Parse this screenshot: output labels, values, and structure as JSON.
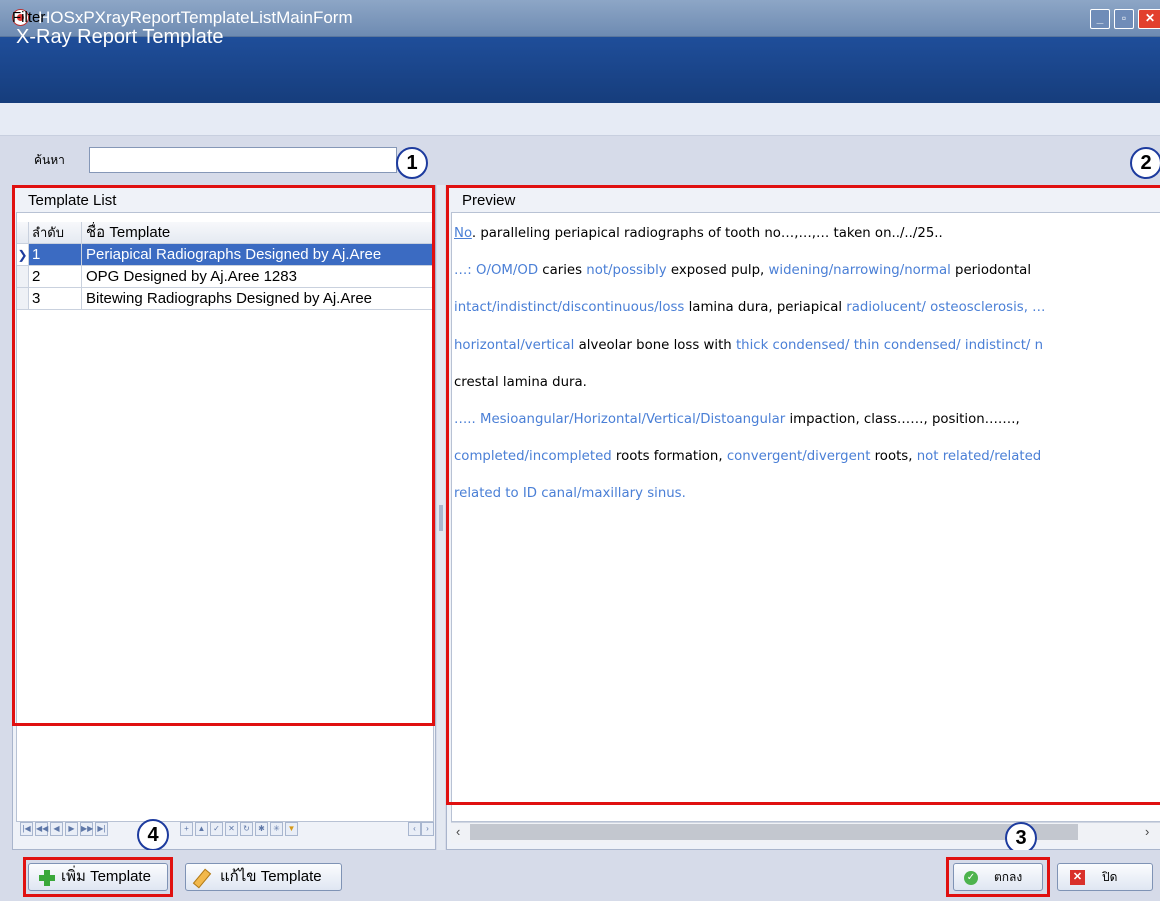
{
  "window": {
    "title": "HOSxPXrayReportTemplateListMainForm"
  },
  "header": {
    "title": "X-Ray Report Template"
  },
  "filter": {
    "section_label": "Filter",
    "search_label": "ค้นหา",
    "search_value": ""
  },
  "callouts": [
    "1",
    "2",
    "3",
    "4"
  ],
  "template_list": {
    "title": "Template List",
    "columns": [
      "ลำดับ",
      "ชื่อ Template"
    ],
    "rows": [
      {
        "no": "1",
        "name": "Periapical Radiographs Designed by Aj.Aree"
      },
      {
        "no": "2",
        "name": "OPG Designed by Aj.Aree 1283"
      },
      {
        "no": "3",
        "name": "Bitewing Radiographs Designed by Aj.Aree"
      }
    ],
    "selected_index": 0
  },
  "preview": {
    "title": "Preview",
    "lines": [
      [
        {
          "t": "No",
          "s": "u"
        },
        {
          "t": ". paralleling periapical radiographs of tooth no…,…,… taken on../../25..",
          "s": "n"
        }
      ],
      [
        {
          "t": "…: O/OM/OD",
          "s": "b"
        },
        {
          "t": " caries ",
          "s": "n"
        },
        {
          "t": "not/possibly",
          "s": "b"
        },
        {
          "t": " exposed pulp, ",
          "s": "n"
        },
        {
          "t": "widening/narrowing/normal",
          "s": "b"
        },
        {
          "t": " periodontal",
          "s": "n"
        }
      ],
      [
        {
          "t": "intact/indistinct/discontinuous/loss",
          "s": "b"
        },
        {
          "t": " lamina dura, periapical ",
          "s": "n"
        },
        {
          "t": "radiolucent/ osteosclerosis, …",
          "s": "b"
        }
      ],
      [
        {
          "t": "horizontal/vertical",
          "s": "b"
        },
        {
          "t": " alveolar bone loss with ",
          "s": "n"
        },
        {
          "t": "thick condensed/ thin condensed/ indistinct/ n",
          "s": "b"
        }
      ],
      [
        {
          "t": "crestal lamina dura.",
          "s": "n"
        }
      ],
      [
        {
          "t": "….. Mesioangular/Horizontal/Vertical/Distoangular",
          "s": "b"
        },
        {
          "t": " impaction, class……, position…….,",
          "s": "n"
        }
      ],
      [
        {
          "t": "completed/incompleted",
          "s": "b"
        },
        {
          "t": " roots formation, ",
          "s": "n"
        },
        {
          "t": "convergent/divergent",
          "s": "b"
        },
        {
          "t": " roots, ",
          "s": "n"
        },
        {
          "t": "not related/related",
          "s": "b"
        }
      ],
      [
        {
          "t": "related to ID canal/maxillary sinus.",
          "s": "b"
        }
      ]
    ]
  },
  "buttons": {
    "add": "เพิ่ม Template",
    "edit": "แก้ไข Template",
    "ok": "ตกลง",
    "close": "ปิด"
  },
  "colors": {
    "header": "#1f4e9a",
    "selection": "#3b6bc2",
    "highlight_text": "#4a7fd6",
    "callout_box": "#e01010"
  }
}
